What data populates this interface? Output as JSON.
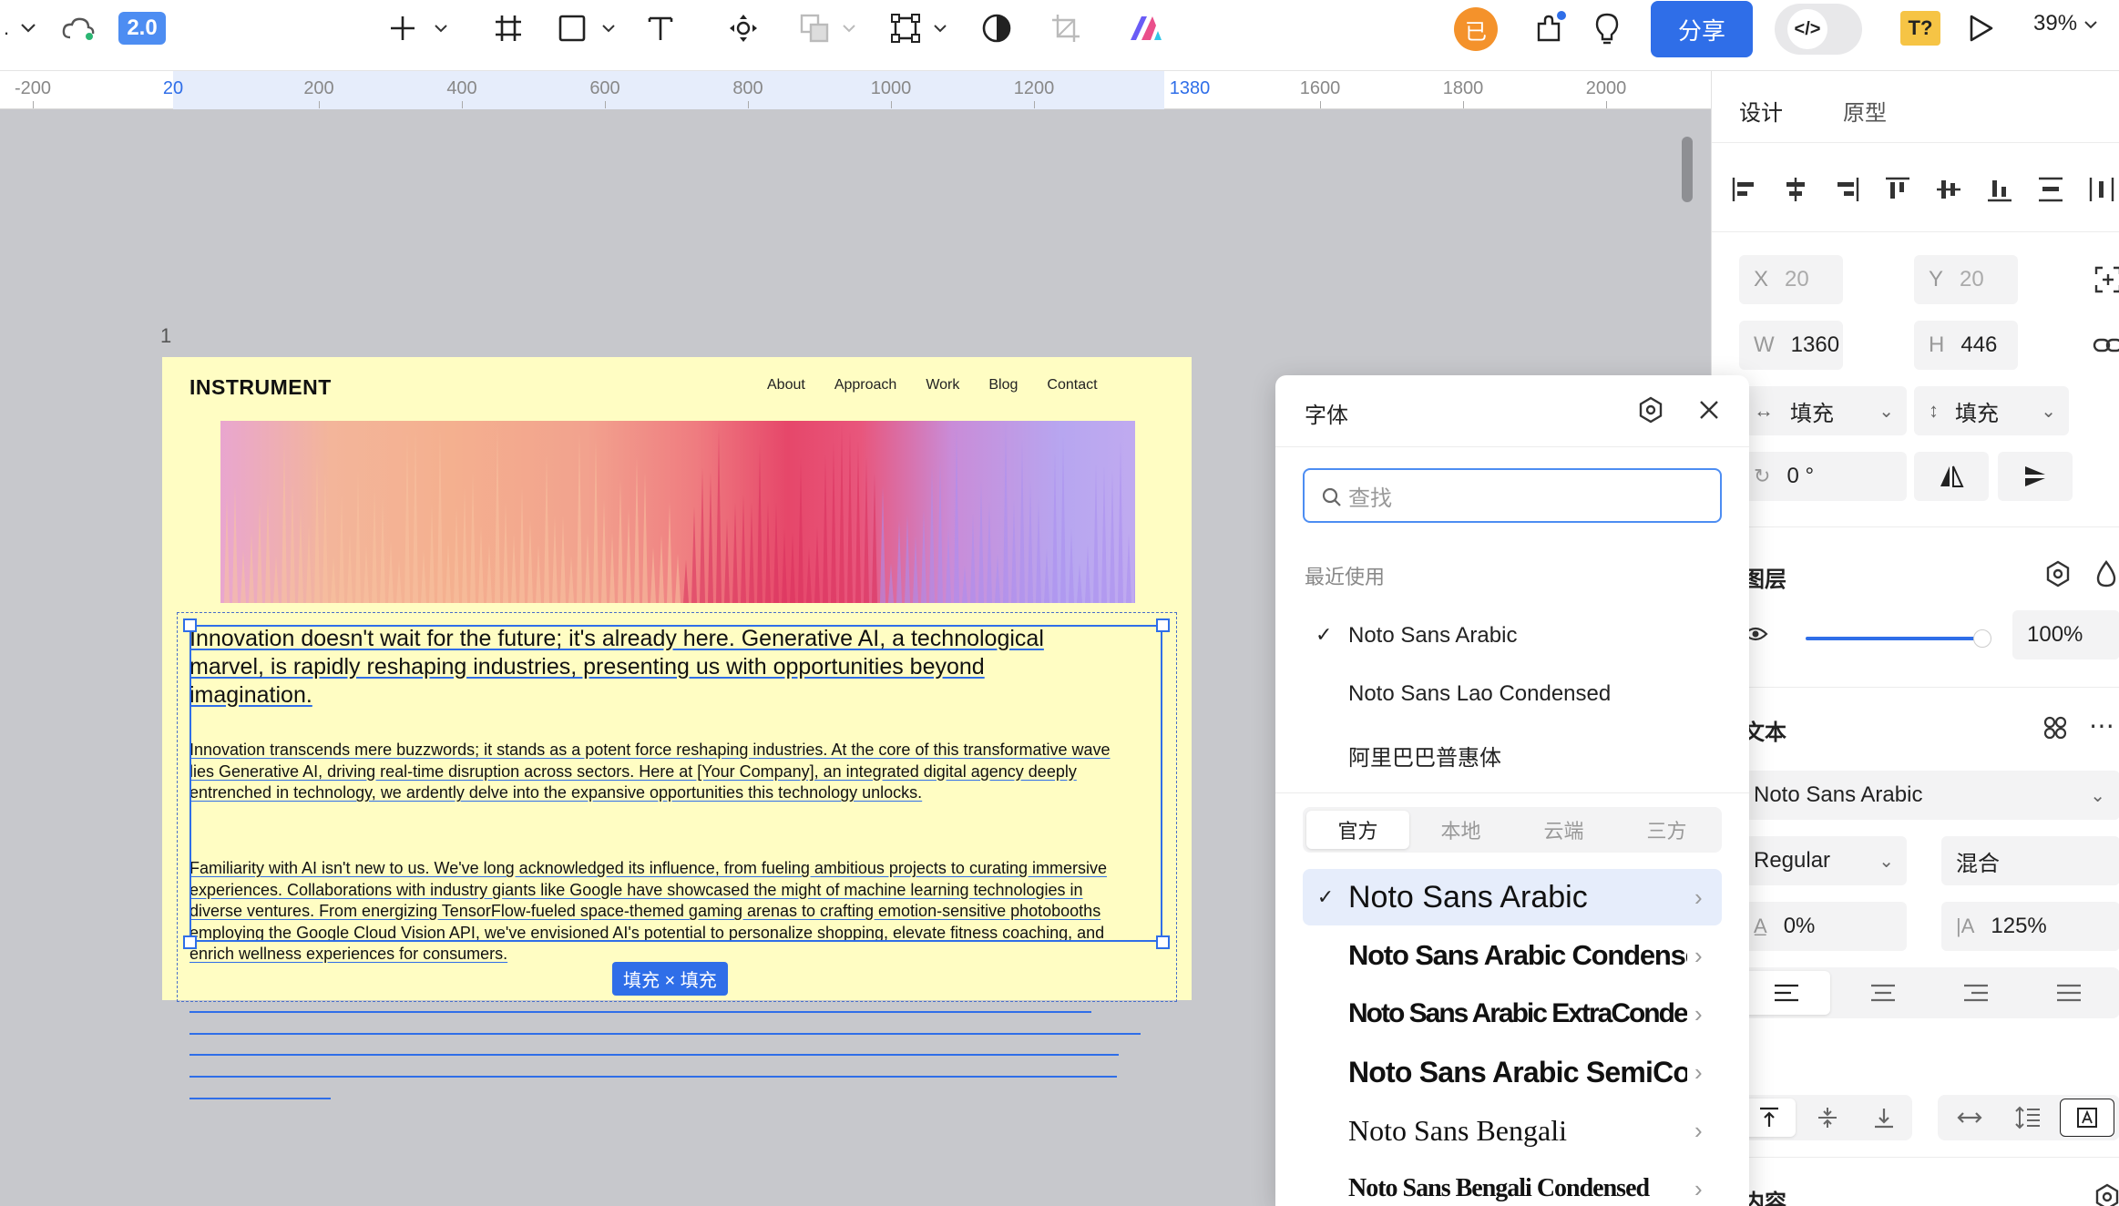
{
  "toolbar": {
    "version": "2.0",
    "avatar_initial": "已",
    "share_label": "分享",
    "code_label": "</>",
    "font_missing_label": "T?",
    "zoom": "39%"
  },
  "ruler": {
    "ticks": [
      "-200",
      "20",
      "200",
      "400",
      "600",
      "800",
      "1000",
      "1200",
      "1380",
      "1600",
      "1800",
      "2000"
    ]
  },
  "canvas": {
    "frame_label": "1",
    "logo": "INSTRUMENT",
    "nav": [
      "About",
      "Approach",
      "Work",
      "Blog",
      "Contact"
    ],
    "lead": "Innovation doesn't wait for the future; it's already here. Generative AI, a technological marvel, is rapidly reshaping industries, presenting us with opportunities beyond imagination.",
    "para1": "Innovation transcends mere buzzwords; it stands as a potent force reshaping industries. At the core of this transformative wave lies Generative AI, driving real-time disruption across sectors. Here at [Your Company], an integrated digital agency deeply entrenched in technology, we ardently delve into the expansive opportunities this technology unlocks.",
    "para2": "Familiarity with AI isn't new to us. We've long acknowledged its influence, from fueling ambitious projects to curating immersive experiences. Collaborations with industry giants like Google have showcased the might of machine learning technologies in diverse ventures. From energizing TensorFlow-fueled space-themed gaming arenas to crafting emotion-sensitive photobooths employing the Google Cloud Vision API, we've envisioned AI's potential to personalize shopping, elevate fitness coaching, and enrich wellness experiences for consumers.",
    "size_tag": "填充 × 填充"
  },
  "right_panel": {
    "tabs": [
      "设计",
      "原型"
    ],
    "x_label": "X",
    "x_value": "20",
    "y_label": "Y",
    "y_value": "20",
    "w_label": "W",
    "w_value": "1360",
    "h_label": "H",
    "h_value": "446",
    "width_mode": "填充",
    "height_mode": "填充",
    "rotation": "0 °",
    "layer_title": "图层",
    "opacity": "100%",
    "text_title": "文本",
    "font_family": "Noto Sans Arabic",
    "font_weight": "Regular",
    "font_size": "混合",
    "letter_spacing": "0%",
    "line_height": "125%",
    "content_title": "内容"
  },
  "font_popup": {
    "title": "字体",
    "search_placeholder": "查找",
    "recent_title": "最近使用",
    "recent": [
      "Noto Sans Arabic",
      "Noto Sans Lao Condensed",
      "阿里巴巴普惠体"
    ],
    "tabs": [
      "官方",
      "本地",
      "云端",
      "三方"
    ],
    "fonts": [
      "Noto Sans Arabic",
      "Noto Sans Arabic Condensed",
      "Noto Sans Arabic ExtraCondensed",
      "Noto Sans Arabic SemiCondensed",
      "Noto Sans Bengali",
      "Noto Sans Bengali Condensed"
    ]
  }
}
